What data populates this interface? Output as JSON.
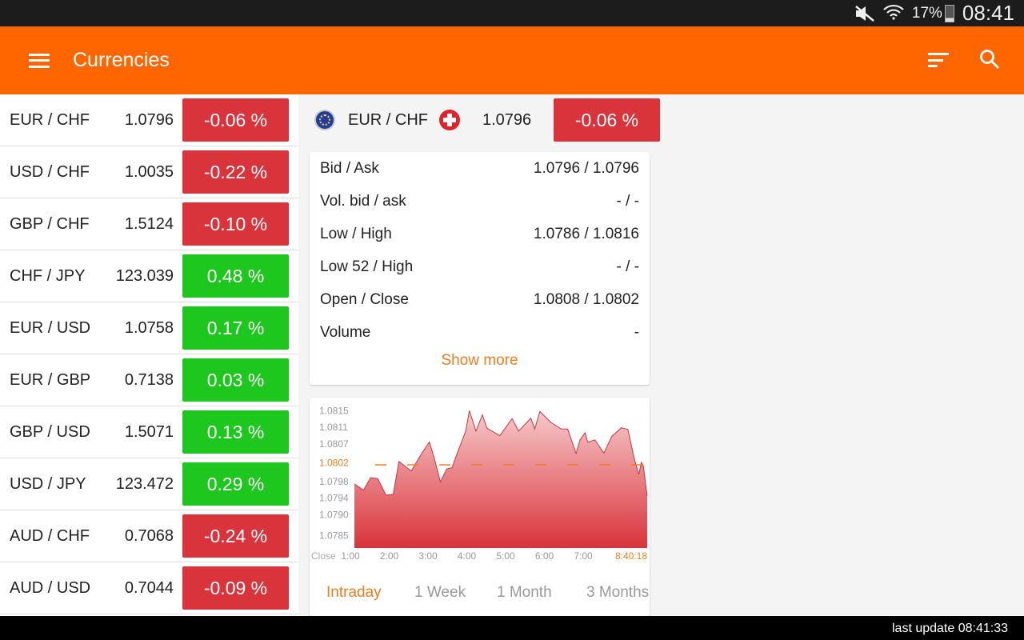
{
  "status_bar": {
    "battery": "17%",
    "time": "08:41",
    "icons": [
      "mute-icon",
      "wifi-icon",
      "battery-icon"
    ]
  },
  "toolbar": {
    "title": "Currencies",
    "icons": [
      "menu-icon",
      "sort-icon",
      "search-icon"
    ]
  },
  "colors": {
    "accent": "#ff6600",
    "negative": "#d9333b",
    "positive": "#1ec71e",
    "highlight": "#ef7d1e"
  },
  "list": [
    {
      "pair": "EUR / CHF",
      "price": "1.0796",
      "change": "-0.06 %",
      "dir": "neg"
    },
    {
      "pair": "USD / CHF",
      "price": "1.0035",
      "change": "-0.22 %",
      "dir": "neg"
    },
    {
      "pair": "GBP / CHF",
      "price": "1.5124",
      "change": "-0.10 %",
      "dir": "neg"
    },
    {
      "pair": "CHF / JPY",
      "price": "123.039",
      "change": "0.48 %",
      "dir": "pos"
    },
    {
      "pair": "EUR / USD",
      "price": "1.0758",
      "change": "0.17 %",
      "dir": "pos"
    },
    {
      "pair": "EUR / GBP",
      "price": "0.7138",
      "change": "0.03 %",
      "dir": "pos"
    },
    {
      "pair": "GBP / USD",
      "price": "1.5071",
      "change": "0.13 %",
      "dir": "pos"
    },
    {
      "pair": "USD / JPY",
      "price": "123.472",
      "change": "0.29 %",
      "dir": "pos"
    },
    {
      "pair": "AUD / CHF",
      "price": "0.7068",
      "change": "-0.24 %",
      "dir": "neg"
    },
    {
      "pair": "AUD / USD",
      "price": "0.7044",
      "change": "-0.09 %",
      "dir": "neg"
    }
  ],
  "detail": {
    "pair": "EUR / CHF",
    "price": "1.0796",
    "change": "-0.06 %",
    "rows": [
      {
        "label": "Bid / Ask",
        "value": "1.0796 / 1.0796"
      },
      {
        "label": "Vol. bid / ask",
        "value": "- / -"
      },
      {
        "label": "Low / High",
        "value": "1.0786 / 1.0816"
      },
      {
        "label": "Low 52 / High",
        "value": "- / -"
      },
      {
        "label": "Open / Close",
        "value": "1.0808 / 1.0802"
      },
      {
        "label": "Volume",
        "value": "-"
      }
    ],
    "show_more": "Show more"
  },
  "chart_data": {
    "type": "area",
    "yticks": [
      "1.0815",
      "1.0811",
      "1.0807",
      "1.0802",
      "1.0798",
      "1.0794",
      "1.0790",
      "1.0785"
    ],
    "ytick_values": [
      1.0815,
      1.0811,
      1.0807,
      1.08025,
      1.0798,
      1.0794,
      1.079,
      1.0785
    ],
    "xticks": [
      "1:00",
      "2:00",
      "3:00",
      "4:00",
      "5:00",
      "6:00",
      "7:00"
    ],
    "x_start_label": "Close",
    "x_end_label": "8:40:18",
    "close_value": 1.0802,
    "close_label": "1.0802",
    "ylim": [
      1.0782,
      1.0817
    ],
    "xlim": [
      "1:07",
      "8:40"
    ],
    "x": [
      "1:07",
      "1:21",
      "1:32",
      "1:43",
      "1:56",
      "2:07",
      "2:16",
      "2:35",
      "2:49",
      "3:03",
      "3:10",
      "3:20",
      "3:30",
      "3:38",
      "3:47",
      "3:59",
      "4:05",
      "4:15",
      "4:25",
      "4:32",
      "4:52",
      "5:11",
      "5:21",
      "5:40",
      "5:46",
      "5:54",
      "6:11",
      "6:27",
      "6:37",
      "6:50",
      "6:56",
      "7:04",
      "7:08",
      "7:19",
      "7:33",
      "7:45",
      "8:00",
      "8:10",
      "8:20",
      "8:27",
      "8:31",
      "8:34",
      "8:40"
    ],
    "y": [
      1.07974,
      1.07959,
      1.07989,
      1.07987,
      1.07947,
      1.07949,
      1.08028,
      1.08005,
      1.08042,
      1.08075,
      1.08039,
      1.07979,
      1.0801,
      1.08013,
      1.08052,
      1.081,
      1.0815,
      1.08101,
      1.0814,
      1.08108,
      1.0809,
      1.08131,
      1.08101,
      1.08132,
      1.08106,
      1.08148,
      1.08122,
      1.08106,
      1.08106,
      1.08047,
      1.0808,
      1.08097,
      1.08074,
      1.0808,
      1.08048,
      1.08088,
      1.08109,
      1.08105,
      1.08035,
      1.07997,
      1.08026,
      1.08017,
      1.07945
    ],
    "grid": false
  },
  "tabs": [
    {
      "label": "Intraday",
      "active": true
    },
    {
      "label": "1 Week"
    },
    {
      "label": "1 Month"
    },
    {
      "label": "3 Months"
    }
  ],
  "footer": {
    "last_update": "last update 08:41:33"
  }
}
